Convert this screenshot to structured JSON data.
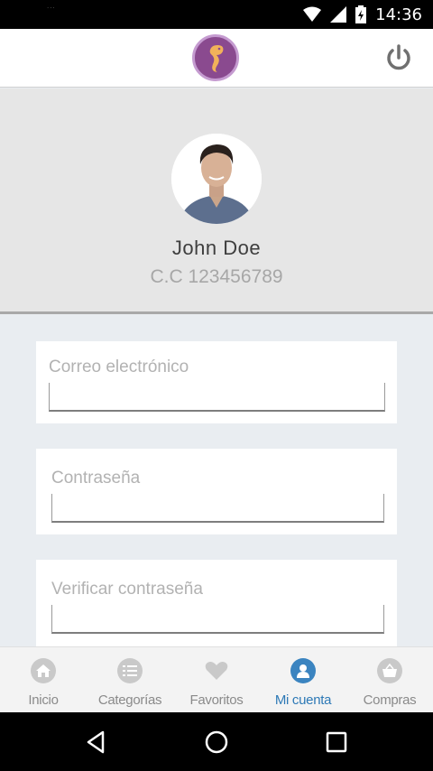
{
  "status_bar": {
    "time": "14:36",
    "notification_text": "..."
  },
  "header": {
    "logo_icon": "seahorse-logo",
    "power_icon": "power-icon"
  },
  "profile": {
    "name": "John Doe",
    "id_text": "C.C 123456789"
  },
  "form": {
    "email_label": "Correo electrónico",
    "email_value": "",
    "password_label": "Contraseña",
    "password_value": "",
    "verify_label": "Verificar contraseña",
    "verify_value": ""
  },
  "bottom_nav": {
    "items": [
      {
        "label": "Inicio",
        "icon": "home-icon"
      },
      {
        "label": "Categorías",
        "icon": "list-icon"
      },
      {
        "label": "Favoritos",
        "icon": "heart-icon"
      },
      {
        "label": "Mi cuenta",
        "icon": "user-icon"
      },
      {
        "label": "Compras",
        "icon": "basket-icon"
      }
    ],
    "active": "Mi cuenta",
    "active_color": "#2d79b6"
  },
  "colors": {
    "brand": "#8a4a8f",
    "accent": "#2d79b6"
  }
}
